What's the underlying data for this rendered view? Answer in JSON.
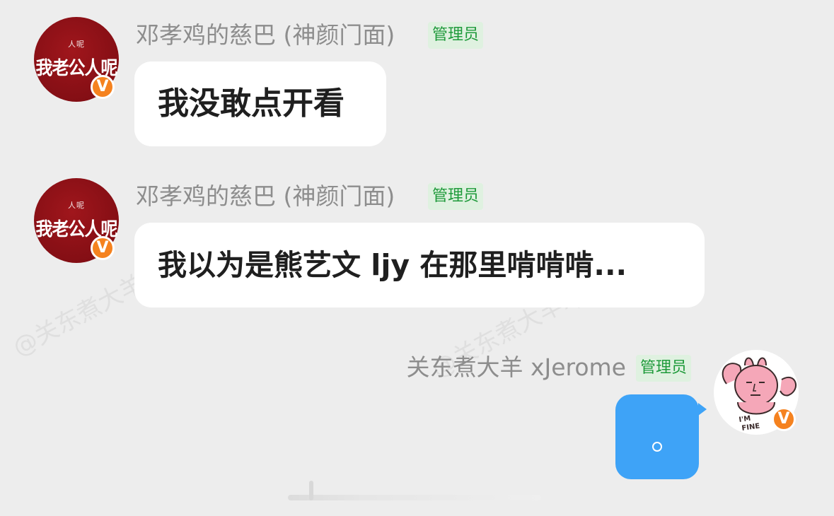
{
  "messages": [
    {
      "sender": "邓孝鸡的慈巴 (神颜门面)",
      "role_tag": "管理员",
      "avatar_small_text": "人呢",
      "avatar_big_text": "我老公人呢",
      "verified_badge": "V",
      "text": "我没敢点开看"
    },
    {
      "sender": "邓孝鸡的慈巴 (神颜门面)",
      "role_tag": "管理员",
      "avatar_small_text": "人呢",
      "avatar_big_text": "我老公人呢",
      "verified_badge": "V",
      "text": "我以为是熊艺文 ljy 在那里啃啃啃..."
    },
    {
      "sender": "关东煮大羊 xJerome",
      "role_tag": "管理员",
      "avatar_icon": "im-fine-cartoon-icon",
      "avatar_caption": "I'M FINE",
      "verified_badge": "V",
      "text": "。"
    }
  ],
  "watermark": "@关东煮大羊xJerome",
  "colors": {
    "background": "#ededed",
    "bubble_other": "#ffffff",
    "bubble_self": "#3ea3f7",
    "admin_tag_bg": "#dff1e0",
    "admin_tag_text": "#1e9a3a",
    "verified_badge": "#f5821f",
    "avatar_red": "#8a1016"
  }
}
